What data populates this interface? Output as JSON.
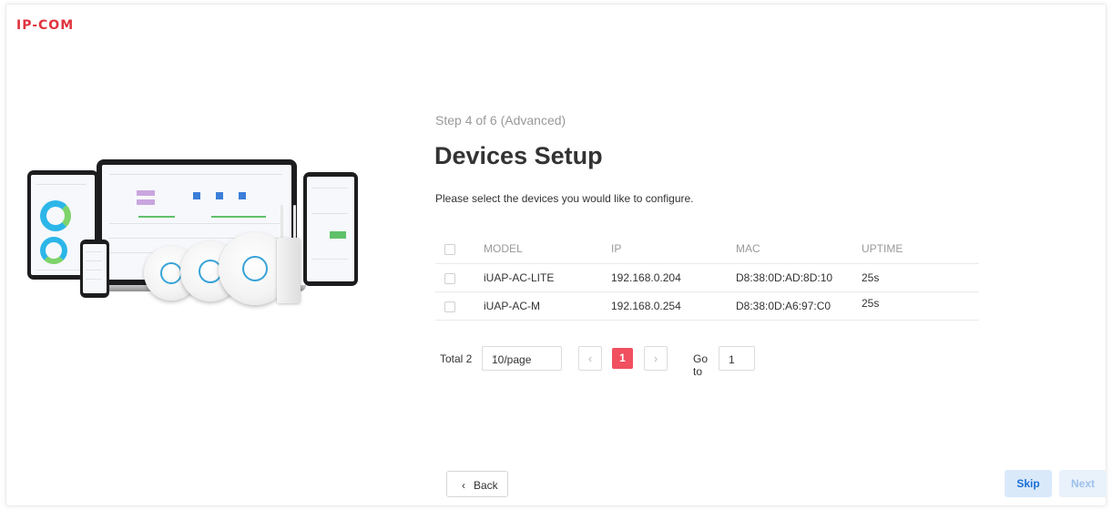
{
  "brand": {
    "logo_text": "IP-COM",
    "accent": "#e0343e"
  },
  "wizard": {
    "step_label": "Step 4 of 6  (Advanced)",
    "title": "Devices Setup",
    "description": "Please select the devices you would like to configure."
  },
  "table": {
    "columns": [
      "MODEL",
      "IP",
      "MAC",
      "UPTIME"
    ],
    "rows": [
      {
        "model": "iUAP-AC-LITE",
        "ip": "192.168.0.204",
        "mac": "D8:38:0D:AD:8D:10",
        "uptime": "25s"
      },
      {
        "model": "iUAP-AC-M",
        "ip": "192.168.0.254",
        "mac": "D8:38:0D:A6:97:C0",
        "uptime": "25s"
      }
    ]
  },
  "pagination": {
    "total_label": "Total 2",
    "page_size": "10/page",
    "current_page": "1",
    "goto_label": "Go to",
    "goto_value": "1",
    "active_color": "#f0505f"
  },
  "actions": {
    "back_label": "Back",
    "skip_label": "Skip",
    "next_label": "Next",
    "skip_color": "#1a6fd6"
  },
  "icons": {
    "back": "chevron-left-icon",
    "prev": "chevron-left-icon",
    "next": "chevron-right-icon",
    "select": "chevron-down-icon"
  }
}
